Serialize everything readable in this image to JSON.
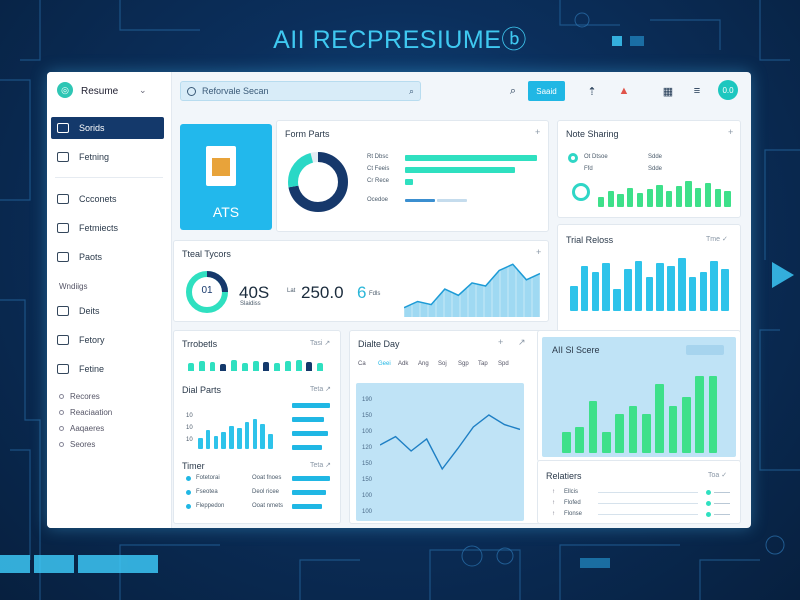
{
  "headline": "AII RECPRESIUMEⓑ",
  "colors": {
    "accent": "#20b7e4",
    "teal": "#2fe0c0",
    "navy": "#14396b",
    "green": "#3ee08a"
  },
  "sidebar": {
    "brand": "Resume",
    "items": [
      {
        "label": "Sorids",
        "icon": "grid-icon",
        "active": true
      },
      {
        "label": "Fetning",
        "icon": "folder-icon"
      },
      {
        "label": "Ccconets",
        "icon": "file-icon"
      },
      {
        "label": "Fetmiects",
        "icon": "mail-icon"
      },
      {
        "label": "Paots",
        "icon": "cloud-icon"
      }
    ],
    "section": "Wndiigs",
    "items2": [
      {
        "label": "Deits",
        "icon": "doc-icon"
      },
      {
        "label": "Fetory",
        "icon": "box-icon"
      },
      {
        "label": "Fetine",
        "icon": "gear-icon"
      }
    ],
    "sub_items": [
      "Recores",
      "Reaciaation",
      "Aaqaeres",
      "Seores"
    ]
  },
  "topbar": {
    "search_placeholder": "Reforvale Secan",
    "search_button": "Saaid",
    "avatar": "0.0"
  },
  "ats_card": {
    "label": "ATS"
  },
  "form_parts": {
    "title": "Form Parts",
    "rows": [
      "Rt Dbsc",
      "Ct Feeis",
      "Cr Rece"
    ],
    "footer": "Ocedoe",
    "donut_fraction": 0.72
  },
  "note_sharing": {
    "title": "Note Sharing",
    "legend": [
      "Ot Dtsoe",
      "Sdde",
      "Ffd",
      "Sdde"
    ],
    "bars": [
      0.3,
      0.5,
      0.4,
      0.6,
      0.45,
      0.55,
      0.7,
      0.5,
      0.65,
      0.8,
      0.6,
      0.75,
      0.55,
      0.5
    ]
  },
  "total_types": {
    "title": "Tteal Tycors",
    "gauge": "01",
    "stat1": "40S",
    "stat1_label": "Slaidiss",
    "stat2_prefix": "Lat",
    "stat2": "250.0",
    "stat3": "6",
    "stat3_label": "Fdls",
    "area": [
      0.15,
      0.25,
      0.2,
      0.45,
      0.35,
      0.55,
      0.5,
      0.75,
      0.85,
      0.6,
      0.7
    ]
  },
  "trial_redos": {
    "title": "Trial Reloss",
    "more": "Tme ✓",
    "bars": [
      0.45,
      0.8,
      0.7,
      0.85,
      0.4,
      0.75,
      0.9,
      0.6,
      0.85,
      0.8,
      0.95,
      0.6,
      0.7,
      0.9,
      0.75
    ]
  },
  "throttle": {
    "title": "Trrobetls",
    "more": "Tasi ↗",
    "bars": [
      0.5,
      0.6,
      0.55,
      0.45,
      0.7,
      0.5,
      0.6,
      0.55,
      0.5,
      0.65,
      0.7,
      0.55,
      0.5
    ]
  },
  "dial_parts": {
    "title": "Dial Parts",
    "more": "Teta ↗",
    "bars": [
      0.3,
      0.5,
      0.35,
      0.45,
      0.6,
      0.55,
      0.7,
      0.8,
      0.65,
      0.4
    ]
  },
  "timer": {
    "title": "Timer",
    "more": "Teta ↗",
    "rows": [
      [
        "Fotetorai",
        "Ooat fnoes"
      ],
      [
        "Fseotea",
        "Deol ricee"
      ],
      [
        "Fleppedon",
        "Ooat nmets"
      ]
    ]
  },
  "daily": {
    "title": "Dialte Day",
    "tabs": [
      "Ca",
      "Geei",
      "Adk",
      "Ang",
      "Soj",
      "Sgp",
      "Tap",
      "Spd"
    ],
    "y_ticks": [
      "190",
      "150",
      "100",
      "120",
      "150",
      "150",
      "100",
      "100"
    ],
    "line": [
      0.55,
      0.62,
      0.5,
      0.6,
      0.35,
      0.52,
      0.7,
      0.8,
      0.72,
      0.68
    ]
  },
  "ai_score": {
    "title": "AII Sl Scere",
    "bars": [
      0.25,
      0.3,
      0.6,
      0.25,
      0.45,
      0.55,
      0.45,
      0.8,
      0.55,
      0.65,
      0.9,
      0.9
    ]
  },
  "relations": {
    "title": "Relatiers",
    "more": "Toa ✓",
    "rows": [
      "Ellcis",
      "Flofed",
      "Flonse"
    ]
  }
}
